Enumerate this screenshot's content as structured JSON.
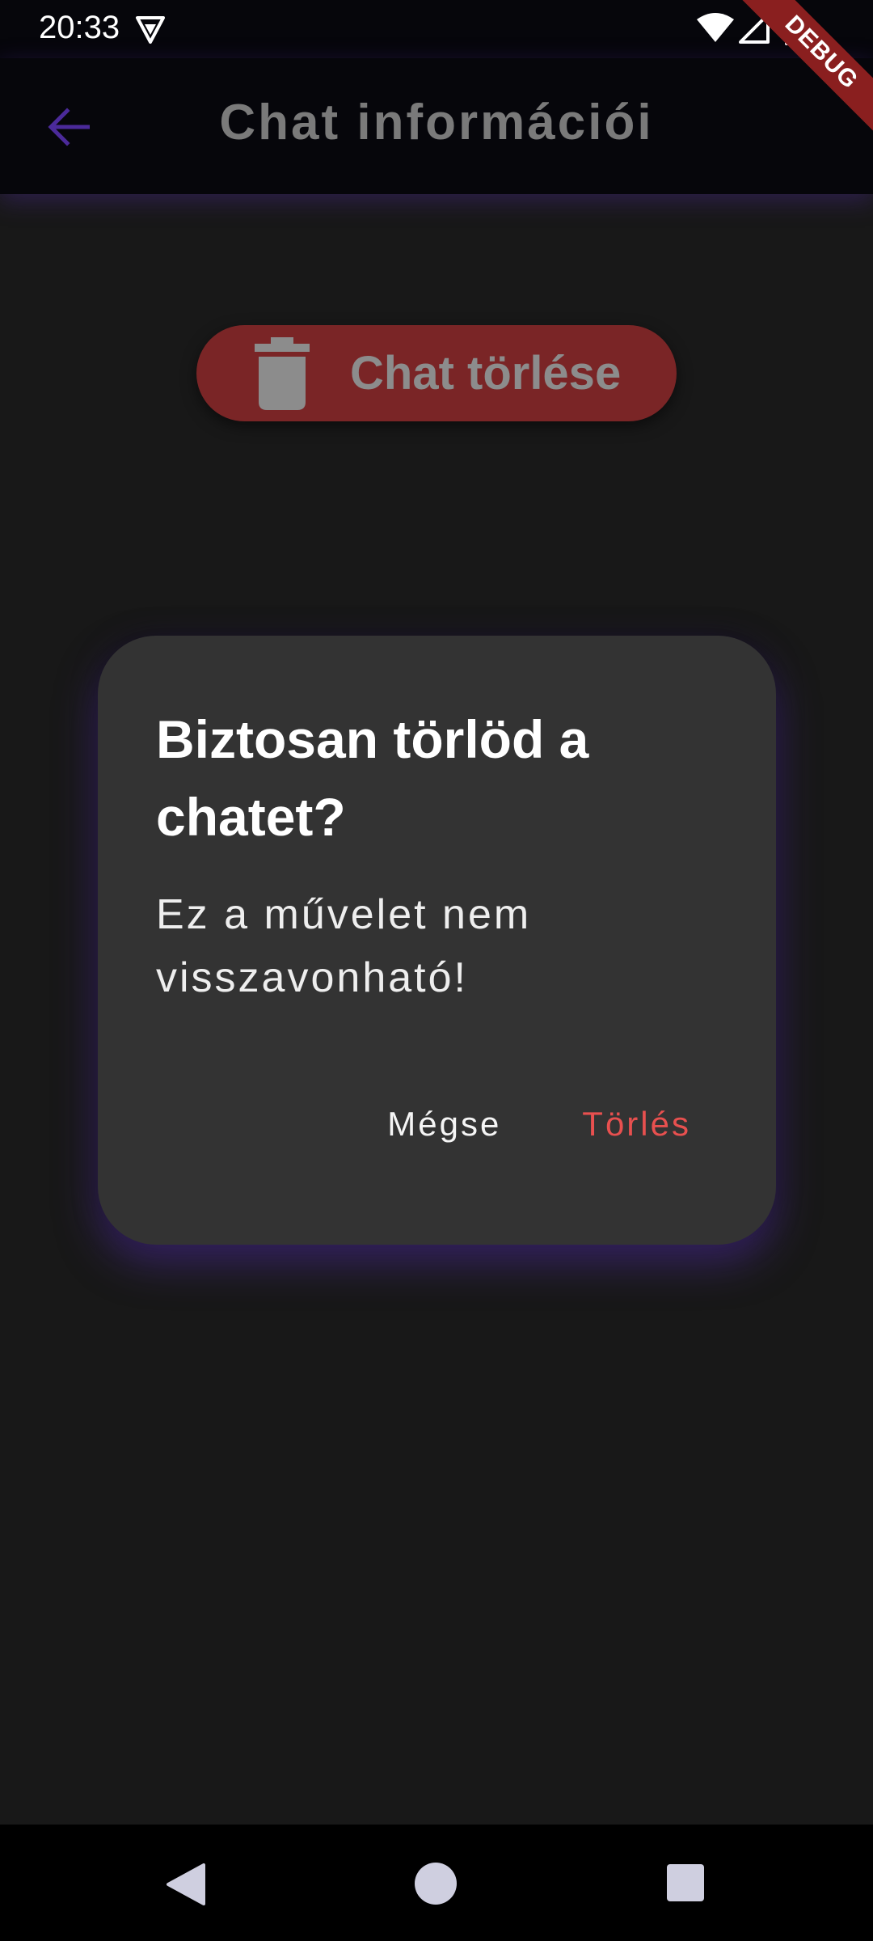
{
  "status_bar": {
    "time": "20:33",
    "icons": [
      "vpn-shield-icon",
      "wifi-icon",
      "signal-icon",
      "battery-icon"
    ]
  },
  "debug_banner": "DEBUG",
  "app_bar": {
    "title": "Chat információi",
    "back_icon": "arrow-back-icon"
  },
  "main": {
    "delete_button_label": "Chat törlése",
    "delete_icon": "trash-icon"
  },
  "dialog": {
    "title": "Biztosan törlöd a chatet?",
    "message": "Ez a művelet nem visszavonható!",
    "cancel_label": "Mégse",
    "confirm_label": "Törlés"
  },
  "colors": {
    "accent": "#4b2a9a",
    "danger": "#e8504f",
    "dialog_bg": "#333333",
    "page_bg": "#181818"
  }
}
